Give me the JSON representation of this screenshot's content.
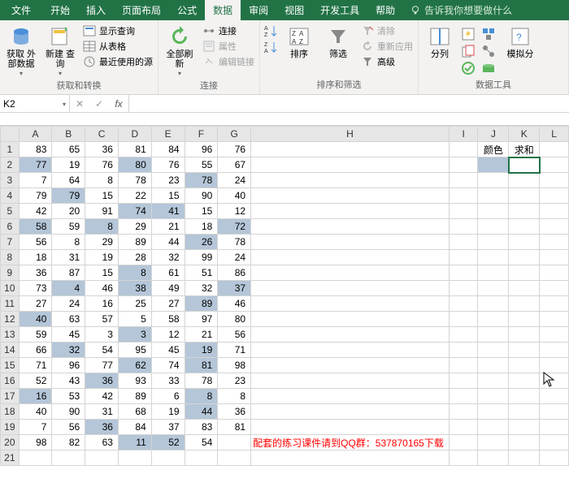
{
  "tabs": {
    "file": "文件",
    "items": [
      "开始",
      "插入",
      "页面布局",
      "公式",
      "数据",
      "审阅",
      "视图",
      "开发工具",
      "帮助"
    ],
    "active": 4,
    "tell_me": "告诉我你想要做什么"
  },
  "ribbon": {
    "group1": {
      "label": "获取和转换",
      "get_data": "获取\n外部数据",
      "new_query": "新建\n查询",
      "show_queries": "显示查询",
      "from_table": "从表格",
      "recent_sources": "最近使用的源"
    },
    "group2": {
      "label": "连接",
      "refresh_all": "全部刷新",
      "connections": "连接",
      "properties": "属性",
      "edit_links": "编辑链接"
    },
    "group3": {
      "label": "排序和筛选",
      "sort": "排序",
      "filter": "筛选",
      "clear": "清除",
      "reapply": "重新应用",
      "advanced": "高级"
    },
    "group4": {
      "label": "数据工具",
      "text_to_cols": "分列",
      "forecast": "模拟分"
    }
  },
  "name_box": "K2",
  "formula_bar": {
    "cancel": "✕",
    "confirm": "✓",
    "fx": "fx",
    "value": ""
  },
  "columns": [
    "A",
    "B",
    "C",
    "D",
    "E",
    "F",
    "G",
    "H",
    "I",
    "J",
    "K",
    "L"
  ],
  "headers": {
    "J1": "颜色",
    "K1": "求和"
  },
  "rows": [
    [
      {
        "v": 83
      },
      {
        "v": 65
      },
      {
        "v": 36
      },
      {
        "v": 81
      },
      {
        "v": 84
      },
      {
        "v": 96
      },
      {
        "v": 76
      }
    ],
    [
      {
        "v": 77,
        "h": 1
      },
      {
        "v": 19
      },
      {
        "v": 76
      },
      {
        "v": 80,
        "h": 1
      },
      {
        "v": 76
      },
      {
        "v": 55
      },
      {
        "v": 67
      }
    ],
    [
      {
        "v": 7
      },
      {
        "v": 64
      },
      {
        "v": 8
      },
      {
        "v": 78
      },
      {
        "v": 23
      },
      {
        "v": 78,
        "h": 1
      },
      {
        "v": 24
      }
    ],
    [
      {
        "v": 79
      },
      {
        "v": 79,
        "h": 1
      },
      {
        "v": 15
      },
      {
        "v": 22
      },
      {
        "v": 15
      },
      {
        "v": 90
      },
      {
        "v": 40
      }
    ],
    [
      {
        "v": 42
      },
      {
        "v": 20
      },
      {
        "v": 91
      },
      {
        "v": 74,
        "h": 1
      },
      {
        "v": 41,
        "h": 1
      },
      {
        "v": 15
      },
      {
        "v": 12
      }
    ],
    [
      {
        "v": 58,
        "h": 1
      },
      {
        "v": 59
      },
      {
        "v": 8,
        "h": 1
      },
      {
        "v": 29
      },
      {
        "v": 21
      },
      {
        "v": 18
      },
      {
        "v": 72,
        "h": 1
      }
    ],
    [
      {
        "v": 56
      },
      {
        "v": 8
      },
      {
        "v": 29
      },
      {
        "v": 89
      },
      {
        "v": 44
      },
      {
        "v": 26,
        "h": 1
      },
      {
        "v": 78
      }
    ],
    [
      {
        "v": 18
      },
      {
        "v": 31
      },
      {
        "v": 19
      },
      {
        "v": 28
      },
      {
        "v": 32
      },
      {
        "v": 99
      },
      {
        "v": 24
      }
    ],
    [
      {
        "v": 36
      },
      {
        "v": 87
      },
      {
        "v": 15
      },
      {
        "v": 8,
        "h": 1
      },
      {
        "v": 61
      },
      {
        "v": 51
      },
      {
        "v": 86
      }
    ],
    [
      {
        "v": 73
      },
      {
        "v": 4,
        "h": 1
      },
      {
        "v": 46
      },
      {
        "v": 38,
        "h": 1
      },
      {
        "v": 49
      },
      {
        "v": 32
      },
      {
        "v": 37,
        "h": 1
      }
    ],
    [
      {
        "v": 27
      },
      {
        "v": 24
      },
      {
        "v": 16
      },
      {
        "v": 25
      },
      {
        "v": 27
      },
      {
        "v": 89,
        "h": 1
      },
      {
        "v": 46
      }
    ],
    [
      {
        "v": 40,
        "h": 1
      },
      {
        "v": 63
      },
      {
        "v": 57
      },
      {
        "v": 5
      },
      {
        "v": 58
      },
      {
        "v": 97
      },
      {
        "v": 80
      }
    ],
    [
      {
        "v": 59
      },
      {
        "v": 45
      },
      {
        "v": 3
      },
      {
        "v": 3,
        "h": 1
      },
      {
        "v": 12
      },
      {
        "v": 21
      },
      {
        "v": 56
      }
    ],
    [
      {
        "v": 66
      },
      {
        "v": 32,
        "h": 1
      },
      {
        "v": 54
      },
      {
        "v": 95
      },
      {
        "v": 45
      },
      {
        "v": 19,
        "h": 1
      },
      {
        "v": 71
      }
    ],
    [
      {
        "v": 71
      },
      {
        "v": 96
      },
      {
        "v": 77
      },
      {
        "v": 62,
        "h": 1
      },
      {
        "v": 74
      },
      {
        "v": 81,
        "h": 1
      },
      {
        "v": 98
      }
    ],
    [
      {
        "v": 52
      },
      {
        "v": 43
      },
      {
        "v": 36,
        "h": 1
      },
      {
        "v": 93
      },
      {
        "v": 33
      },
      {
        "v": 78
      },
      {
        "v": 23
      }
    ],
    [
      {
        "v": 16,
        "h": 1
      },
      {
        "v": 53
      },
      {
        "v": 42
      },
      {
        "v": 89
      },
      {
        "v": 6
      },
      {
        "v": 8,
        "h": 1
      },
      {
        "v": 8
      }
    ],
    [
      {
        "v": 40
      },
      {
        "v": 90
      },
      {
        "v": 31
      },
      {
        "v": 68
      },
      {
        "v": 19
      },
      {
        "v": 44,
        "h": 1
      },
      {
        "v": 36
      }
    ],
    [
      {
        "v": 7
      },
      {
        "v": 56
      },
      {
        "v": 36,
        "h": 1
      },
      {
        "v": 84
      },
      {
        "v": 37
      },
      {
        "v": 83
      },
      {
        "v": 81
      }
    ],
    [
      {
        "v": 98
      },
      {
        "v": 82
      },
      {
        "v": 63
      },
      {
        "v": 11,
        "h": 1
      },
      {
        "v": 52,
        "h": 1
      },
      {
        "v": 54
      },
      {
        "v": ""
      }
    ]
  ],
  "footer_text": "配套的练习课件请到QQ群：537870165下载"
}
